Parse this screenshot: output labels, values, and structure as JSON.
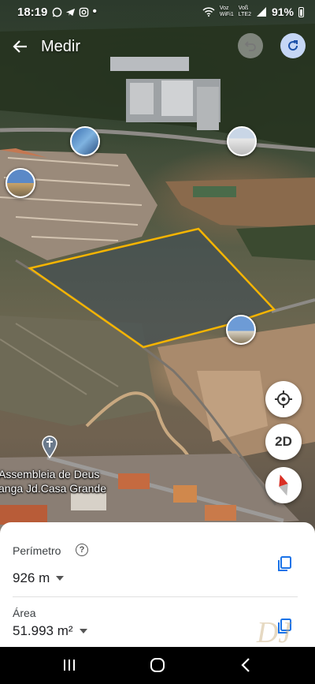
{
  "status_bar": {
    "time": "18:19",
    "network_top": "Voz",
    "network_bottom": "WiFi1",
    "network2_top": "Voß",
    "network2_bottom": "LTE2",
    "battery": "91%"
  },
  "app_bar": {
    "title": "Medir"
  },
  "map": {
    "place_label_line1": "Assembleia de Deus",
    "place_label_line2": "anga Jd.Casa Grande",
    "measure_color": "#f5b400"
  },
  "controls": {
    "view_mode_label": "2D"
  },
  "measurement": {
    "perimeter_label": "Perímetro",
    "perimeter_value": "926 m",
    "area_label": "Área",
    "area_value": "51.993 m²"
  },
  "watermark": {
    "text": "DAYANA"
  },
  "colors": {
    "accent": "#1a73e8",
    "redo_bg": "#c5d6f5"
  }
}
